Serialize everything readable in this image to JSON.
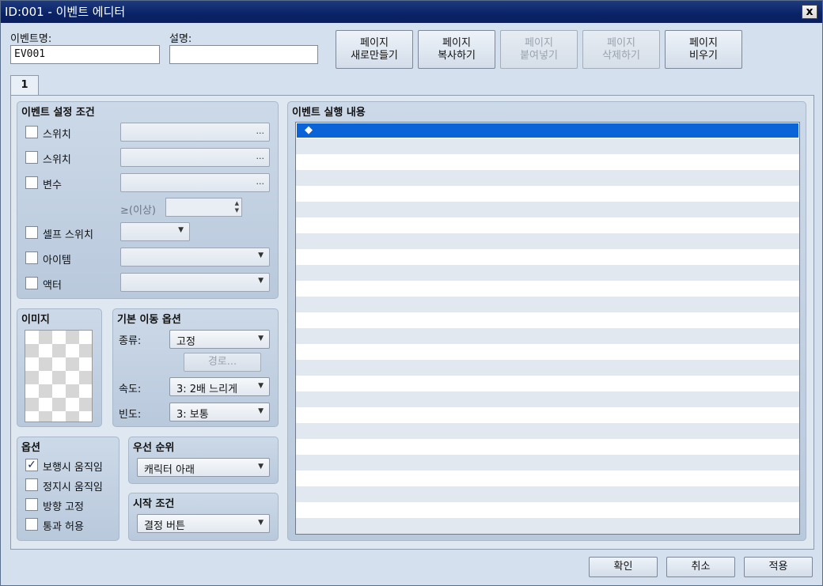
{
  "window": {
    "title": "ID:001 - 이벤트 에디터",
    "close_label": "x"
  },
  "header": {
    "name_label": "이벤트명:",
    "name_value": "EV001",
    "desc_label": "설명:",
    "desc_value": ""
  },
  "page_buttons": {
    "new": [
      "페이지",
      "새로만들기"
    ],
    "copy": [
      "페이지",
      "복사하기"
    ],
    "paste": [
      "페이지",
      "붙여넣기"
    ],
    "delete": [
      "페이지",
      "삭제하기"
    ],
    "clear": [
      "페이지",
      "비우기"
    ]
  },
  "tabs": [
    {
      "label": "1"
    }
  ],
  "conditions": {
    "title": "이벤트 설정 조건",
    "switch1": "스위치",
    "switch2": "스위치",
    "variable": "변수",
    "gte_label": "≥(이상)",
    "self_switch": "셀프 스위치",
    "item": "아이템",
    "actor": "액터",
    "ellipsis": "..."
  },
  "image": {
    "title": "이미지"
  },
  "movement": {
    "title": "기본 이동 옵션",
    "type_label": "종류:",
    "type_value": "고정",
    "route_button": "경로...",
    "speed_label": "속도:",
    "speed_value": "3: 2배 느리게",
    "freq_label": "빈도:",
    "freq_value": "3: 보통"
  },
  "options": {
    "title": "옵션",
    "walking": {
      "label": "보행시 움직임",
      "checked": "✓"
    },
    "stepping": {
      "label": "정지시 움직임"
    },
    "direction_fix": {
      "label": "방향 고정"
    },
    "through": {
      "label": "통과 허용"
    }
  },
  "priority": {
    "title": "우선 순위",
    "value": "캐릭터 아래"
  },
  "trigger": {
    "title": "시작 조건",
    "value": "결정 버튼"
  },
  "contents": {
    "title": "이벤트 실행 내용",
    "first_row": "◆"
  },
  "footer": {
    "ok": "확인",
    "cancel": "취소",
    "apply": "적용"
  },
  "icons": {
    "dropdown": "▼",
    "spin_up": "▲",
    "spin_down": "▼"
  }
}
